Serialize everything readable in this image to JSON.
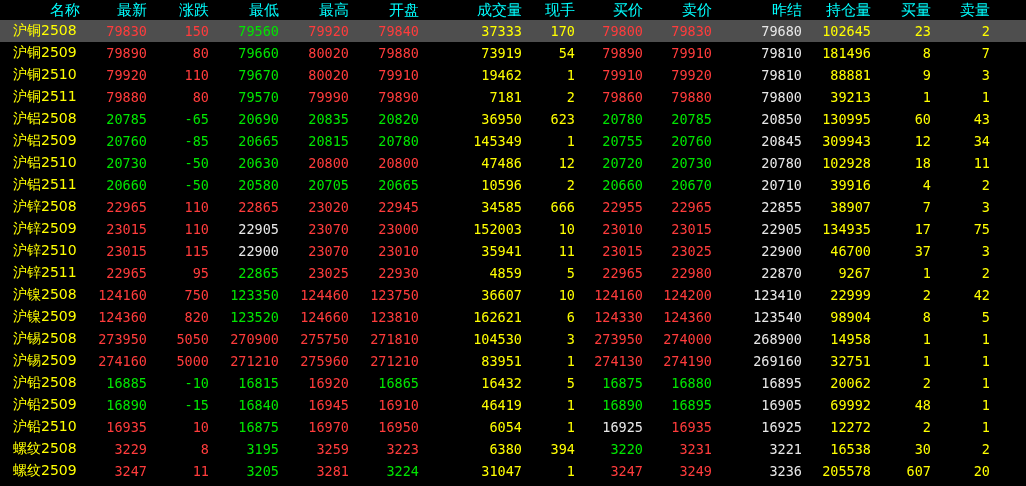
{
  "columns": [
    {
      "label": "名称",
      "kind": "name"
    },
    {
      "label": "最新",
      "kind": "price"
    },
    {
      "label": "涨跌",
      "kind": "price"
    },
    {
      "label": "最低",
      "kind": "price"
    },
    {
      "label": "最高",
      "kind": "price"
    },
    {
      "label": "开盘",
      "kind": "price"
    },
    {
      "label": "成交量",
      "kind": "volume"
    },
    {
      "label": "现手",
      "kind": "volume"
    },
    {
      "label": "买价",
      "kind": "price"
    },
    {
      "label": "卖价",
      "kind": "price"
    },
    {
      "label": "昨结",
      "kind": "settle"
    },
    {
      "label": "持仓量",
      "kind": "volume"
    },
    {
      "label": "买量",
      "kind": "volume"
    },
    {
      "label": "卖量",
      "kind": "volume"
    }
  ],
  "rows": [
    {
      "selected": true,
      "cells": [
        {
          "text": "沪铜2508"
        },
        {
          "text": "79830",
          "color": "#ff3c3c"
        },
        {
          "text": "150",
          "color": "#ff3c3c"
        },
        {
          "text": "79560",
          "color": "#00e600"
        },
        {
          "text": "79920",
          "color": "#ff3c3c"
        },
        {
          "text": "79840",
          "color": "#ff3c3c"
        },
        {
          "text": "37333"
        },
        {
          "text": "170"
        },
        {
          "text": "79800",
          "color": "#ff3c3c"
        },
        {
          "text": "79830",
          "color": "#ff3c3c"
        },
        {
          "text": "79680"
        },
        {
          "text": "102645"
        },
        {
          "text": "23"
        },
        {
          "text": "2"
        }
      ]
    },
    {
      "selected": false,
      "cells": [
        {
          "text": "沪铜2509"
        },
        {
          "text": "79890",
          "color": "#ff3c3c"
        },
        {
          "text": "80",
          "color": "#ff3c3c"
        },
        {
          "text": "79660",
          "color": "#00e600"
        },
        {
          "text": "80020",
          "color": "#ff3c3c"
        },
        {
          "text": "79880",
          "color": "#ff3c3c"
        },
        {
          "text": "73919"
        },
        {
          "text": "54"
        },
        {
          "text": "79890",
          "color": "#ff3c3c"
        },
        {
          "text": "79910",
          "color": "#ff3c3c"
        },
        {
          "text": "79810"
        },
        {
          "text": "181496"
        },
        {
          "text": "8"
        },
        {
          "text": "7"
        }
      ]
    },
    {
      "selected": false,
      "cells": [
        {
          "text": "沪铜2510"
        },
        {
          "text": "79920",
          "color": "#ff3c3c"
        },
        {
          "text": "110",
          "color": "#ff3c3c"
        },
        {
          "text": "79670",
          "color": "#00e600"
        },
        {
          "text": "80020",
          "color": "#ff3c3c"
        },
        {
          "text": "79910",
          "color": "#ff3c3c"
        },
        {
          "text": "19462"
        },
        {
          "text": "1"
        },
        {
          "text": "79910",
          "color": "#ff3c3c"
        },
        {
          "text": "79920",
          "color": "#ff3c3c"
        },
        {
          "text": "79810"
        },
        {
          "text": "88881"
        },
        {
          "text": "9"
        },
        {
          "text": "3"
        }
      ]
    },
    {
      "selected": false,
      "cells": [
        {
          "text": "沪铜2511"
        },
        {
          "text": "79880",
          "color": "#ff3c3c"
        },
        {
          "text": "80",
          "color": "#ff3c3c"
        },
        {
          "text": "79570",
          "color": "#00e600"
        },
        {
          "text": "79990",
          "color": "#ff3c3c"
        },
        {
          "text": "79890",
          "color": "#ff3c3c"
        },
        {
          "text": "7181"
        },
        {
          "text": "2"
        },
        {
          "text": "79860",
          "color": "#ff3c3c"
        },
        {
          "text": "79880",
          "color": "#ff3c3c"
        },
        {
          "text": "79800"
        },
        {
          "text": "39213"
        },
        {
          "text": "1"
        },
        {
          "text": "1"
        }
      ]
    },
    {
      "selected": false,
      "cells": [
        {
          "text": "沪铝2508"
        },
        {
          "text": "20785",
          "color": "#00e600"
        },
        {
          "text": "-65",
          "color": "#00e600"
        },
        {
          "text": "20690",
          "color": "#00e600"
        },
        {
          "text": "20835",
          "color": "#00e600"
        },
        {
          "text": "20820",
          "color": "#00e600"
        },
        {
          "text": "36950"
        },
        {
          "text": "623"
        },
        {
          "text": "20780",
          "color": "#00e600"
        },
        {
          "text": "20785",
          "color": "#00e600"
        },
        {
          "text": "20850"
        },
        {
          "text": "130995"
        },
        {
          "text": "60"
        },
        {
          "text": "43"
        }
      ]
    },
    {
      "selected": false,
      "cells": [
        {
          "text": "沪铝2509"
        },
        {
          "text": "20760",
          "color": "#00e600"
        },
        {
          "text": "-85",
          "color": "#00e600"
        },
        {
          "text": "20665",
          "color": "#00e600"
        },
        {
          "text": "20815",
          "color": "#00e600"
        },
        {
          "text": "20780",
          "color": "#00e600"
        },
        {
          "text": "145349"
        },
        {
          "text": "1"
        },
        {
          "text": "20755",
          "color": "#00e600"
        },
        {
          "text": "20760",
          "color": "#00e600"
        },
        {
          "text": "20845"
        },
        {
          "text": "309943"
        },
        {
          "text": "12"
        },
        {
          "text": "34"
        }
      ]
    },
    {
      "selected": false,
      "cells": [
        {
          "text": "沪铝2510"
        },
        {
          "text": "20730",
          "color": "#00e600"
        },
        {
          "text": "-50",
          "color": "#00e600"
        },
        {
          "text": "20630",
          "color": "#00e600"
        },
        {
          "text": "20800",
          "color": "#ff3c3c"
        },
        {
          "text": "20800",
          "color": "#ff3c3c"
        },
        {
          "text": "47486"
        },
        {
          "text": "12"
        },
        {
          "text": "20720",
          "color": "#00e600"
        },
        {
          "text": "20730",
          "color": "#00e600"
        },
        {
          "text": "20780"
        },
        {
          "text": "102928"
        },
        {
          "text": "18"
        },
        {
          "text": "11"
        }
      ]
    },
    {
      "selected": false,
      "cells": [
        {
          "text": "沪铝2511"
        },
        {
          "text": "20660",
          "color": "#00e600"
        },
        {
          "text": "-50",
          "color": "#00e600"
        },
        {
          "text": "20580",
          "color": "#00e600"
        },
        {
          "text": "20705",
          "color": "#00e600"
        },
        {
          "text": "20665",
          "color": "#00e600"
        },
        {
          "text": "10596"
        },
        {
          "text": "2"
        },
        {
          "text": "20660",
          "color": "#00e600"
        },
        {
          "text": "20670",
          "color": "#00e600"
        },
        {
          "text": "20710"
        },
        {
          "text": "39916"
        },
        {
          "text": "4"
        },
        {
          "text": "2"
        }
      ]
    },
    {
      "selected": false,
      "cells": [
        {
          "text": "沪锌2508"
        },
        {
          "text": "22965",
          "color": "#ff3c3c"
        },
        {
          "text": "110",
          "color": "#ff3c3c"
        },
        {
          "text": "22865",
          "color": "#ff3c3c"
        },
        {
          "text": "23020",
          "color": "#ff3c3c"
        },
        {
          "text": "22945",
          "color": "#ff3c3c"
        },
        {
          "text": "34585"
        },
        {
          "text": "666"
        },
        {
          "text": "22955",
          "color": "#ff3c3c"
        },
        {
          "text": "22965",
          "color": "#ff3c3c"
        },
        {
          "text": "22855"
        },
        {
          "text": "38907"
        },
        {
          "text": "7"
        },
        {
          "text": "3"
        }
      ]
    },
    {
      "selected": false,
      "cells": [
        {
          "text": "沪锌2509"
        },
        {
          "text": "23015",
          "color": "#ff3c3c"
        },
        {
          "text": "110",
          "color": "#ff3c3c"
        },
        {
          "text": "22905",
          "color": "#e8e8e8"
        },
        {
          "text": "23070",
          "color": "#ff3c3c"
        },
        {
          "text": "23000",
          "color": "#ff3c3c"
        },
        {
          "text": "152003"
        },
        {
          "text": "10"
        },
        {
          "text": "23010",
          "color": "#ff3c3c"
        },
        {
          "text": "23015",
          "color": "#ff3c3c"
        },
        {
          "text": "22905"
        },
        {
          "text": "134935"
        },
        {
          "text": "17"
        },
        {
          "text": "75"
        }
      ]
    },
    {
      "selected": false,
      "cells": [
        {
          "text": "沪锌2510"
        },
        {
          "text": "23015",
          "color": "#ff3c3c"
        },
        {
          "text": "115",
          "color": "#ff3c3c"
        },
        {
          "text": "22900",
          "color": "#e8e8e8"
        },
        {
          "text": "23070",
          "color": "#ff3c3c"
        },
        {
          "text": "23010",
          "color": "#ff3c3c"
        },
        {
          "text": "35941"
        },
        {
          "text": "11"
        },
        {
          "text": "23015",
          "color": "#ff3c3c"
        },
        {
          "text": "23025",
          "color": "#ff3c3c"
        },
        {
          "text": "22900"
        },
        {
          "text": "46700"
        },
        {
          "text": "37"
        },
        {
          "text": "3"
        }
      ]
    },
    {
      "selected": false,
      "cells": [
        {
          "text": "沪锌2511"
        },
        {
          "text": "22965",
          "color": "#ff3c3c"
        },
        {
          "text": "95",
          "color": "#ff3c3c"
        },
        {
          "text": "22865",
          "color": "#00e600"
        },
        {
          "text": "23025",
          "color": "#ff3c3c"
        },
        {
          "text": "22930",
          "color": "#ff3c3c"
        },
        {
          "text": "4859"
        },
        {
          "text": "5"
        },
        {
          "text": "22965",
          "color": "#ff3c3c"
        },
        {
          "text": "22980",
          "color": "#ff3c3c"
        },
        {
          "text": "22870"
        },
        {
          "text": "9267"
        },
        {
          "text": "1"
        },
        {
          "text": "2"
        }
      ]
    },
    {
      "selected": false,
      "cells": [
        {
          "text": "沪镍2508"
        },
        {
          "text": "124160",
          "color": "#ff3c3c"
        },
        {
          "text": "750",
          "color": "#ff3c3c"
        },
        {
          "text": "123350",
          "color": "#00e600"
        },
        {
          "text": "124460",
          "color": "#ff3c3c"
        },
        {
          "text": "123750",
          "color": "#ff3c3c"
        },
        {
          "text": "36607"
        },
        {
          "text": "10"
        },
        {
          "text": "124160",
          "color": "#ff3c3c"
        },
        {
          "text": "124200",
          "color": "#ff3c3c"
        },
        {
          "text": "123410"
        },
        {
          "text": "22999"
        },
        {
          "text": "2"
        },
        {
          "text": "42"
        }
      ]
    },
    {
      "selected": false,
      "cells": [
        {
          "text": "沪镍2509"
        },
        {
          "text": "124360",
          "color": "#ff3c3c"
        },
        {
          "text": "820",
          "color": "#ff3c3c"
        },
        {
          "text": "123520",
          "color": "#00e600"
        },
        {
          "text": "124660",
          "color": "#ff3c3c"
        },
        {
          "text": "123810",
          "color": "#ff3c3c"
        },
        {
          "text": "162621"
        },
        {
          "text": "6"
        },
        {
          "text": "124330",
          "color": "#ff3c3c"
        },
        {
          "text": "124360",
          "color": "#ff3c3c"
        },
        {
          "text": "123540"
        },
        {
          "text": "98904"
        },
        {
          "text": "8"
        },
        {
          "text": "5"
        }
      ]
    },
    {
      "selected": false,
      "cells": [
        {
          "text": "沪锡2508"
        },
        {
          "text": "273950",
          "color": "#ff3c3c"
        },
        {
          "text": "5050",
          "color": "#ff3c3c"
        },
        {
          "text": "270900",
          "color": "#ff3c3c"
        },
        {
          "text": "275750",
          "color": "#ff3c3c"
        },
        {
          "text": "271810",
          "color": "#ff3c3c"
        },
        {
          "text": "104530"
        },
        {
          "text": "3"
        },
        {
          "text": "273950",
          "color": "#ff3c3c"
        },
        {
          "text": "274000",
          "color": "#ff3c3c"
        },
        {
          "text": "268900"
        },
        {
          "text": "14958"
        },
        {
          "text": "1"
        },
        {
          "text": "1"
        }
      ]
    },
    {
      "selected": false,
      "cells": [
        {
          "text": "沪锡2509"
        },
        {
          "text": "274160",
          "color": "#ff3c3c"
        },
        {
          "text": "5000",
          "color": "#ff3c3c"
        },
        {
          "text": "271210",
          "color": "#ff3c3c"
        },
        {
          "text": "275960",
          "color": "#ff3c3c"
        },
        {
          "text": "271210",
          "color": "#ff3c3c"
        },
        {
          "text": "83951"
        },
        {
          "text": "1"
        },
        {
          "text": "274130",
          "color": "#ff3c3c"
        },
        {
          "text": "274190",
          "color": "#ff3c3c"
        },
        {
          "text": "269160"
        },
        {
          "text": "32751"
        },
        {
          "text": "1"
        },
        {
          "text": "1"
        }
      ]
    },
    {
      "selected": false,
      "cells": [
        {
          "text": "沪铅2508"
        },
        {
          "text": "16885",
          "color": "#00e600"
        },
        {
          "text": "-10",
          "color": "#00e600"
        },
        {
          "text": "16815",
          "color": "#00e600"
        },
        {
          "text": "16920",
          "color": "#ff3c3c"
        },
        {
          "text": "16865",
          "color": "#00e600"
        },
        {
          "text": "16432"
        },
        {
          "text": "5"
        },
        {
          "text": "16875",
          "color": "#00e600"
        },
        {
          "text": "16880",
          "color": "#00e600"
        },
        {
          "text": "16895"
        },
        {
          "text": "20062"
        },
        {
          "text": "2"
        },
        {
          "text": "1"
        }
      ]
    },
    {
      "selected": false,
      "cells": [
        {
          "text": "沪铅2509"
        },
        {
          "text": "16890",
          "color": "#00e600"
        },
        {
          "text": "-15",
          "color": "#00e600"
        },
        {
          "text": "16840",
          "color": "#00e600"
        },
        {
          "text": "16945",
          "color": "#ff3c3c"
        },
        {
          "text": "16910",
          "color": "#ff3c3c"
        },
        {
          "text": "46419"
        },
        {
          "text": "1"
        },
        {
          "text": "16890",
          "color": "#00e600"
        },
        {
          "text": "16895",
          "color": "#00e600"
        },
        {
          "text": "16905"
        },
        {
          "text": "69992"
        },
        {
          "text": "48"
        },
        {
          "text": "1"
        }
      ]
    },
    {
      "selected": false,
      "cells": [
        {
          "text": "沪铅2510"
        },
        {
          "text": "16935",
          "color": "#ff3c3c"
        },
        {
          "text": "10",
          "color": "#ff3c3c"
        },
        {
          "text": "16875",
          "color": "#00e600"
        },
        {
          "text": "16970",
          "color": "#ff3c3c"
        },
        {
          "text": "16950",
          "color": "#ff3c3c"
        },
        {
          "text": "6054"
        },
        {
          "text": "1"
        },
        {
          "text": "16925",
          "color": "#e8e8e8"
        },
        {
          "text": "16935",
          "color": "#ff3c3c"
        },
        {
          "text": "16925"
        },
        {
          "text": "12272"
        },
        {
          "text": "2"
        },
        {
          "text": "1"
        }
      ]
    },
    {
      "selected": false,
      "cells": [
        {
          "text": "螺纹2508"
        },
        {
          "text": "3229",
          "color": "#ff3c3c"
        },
        {
          "text": "8",
          "color": "#ff3c3c"
        },
        {
          "text": "3195",
          "color": "#00e600"
        },
        {
          "text": "3259",
          "color": "#ff3c3c"
        },
        {
          "text": "3223",
          "color": "#ff3c3c"
        },
        {
          "text": "6380"
        },
        {
          "text": "394"
        },
        {
          "text": "3220",
          "color": "#00e600"
        },
        {
          "text": "3231",
          "color": "#ff3c3c"
        },
        {
          "text": "3221"
        },
        {
          "text": "16538"
        },
        {
          "text": "30"
        },
        {
          "text": "2"
        }
      ]
    },
    {
      "selected": false,
      "cells": [
        {
          "text": "螺纹2509"
        },
        {
          "text": "3247",
          "color": "#ff3c3c"
        },
        {
          "text": "11",
          "color": "#ff3c3c"
        },
        {
          "text": "3205",
          "color": "#00e600"
        },
        {
          "text": "3281",
          "color": "#ff3c3c"
        },
        {
          "text": "3224",
          "color": "#00e600"
        },
        {
          "text": "31047"
        },
        {
          "text": "1"
        },
        {
          "text": "3247",
          "color": "#ff3c3c"
        },
        {
          "text": "3249",
          "color": "#ff3c3c"
        },
        {
          "text": "3236"
        },
        {
          "text": "205578"
        },
        {
          "text": "607"
        },
        {
          "text": "20"
        }
      ]
    }
  ]
}
